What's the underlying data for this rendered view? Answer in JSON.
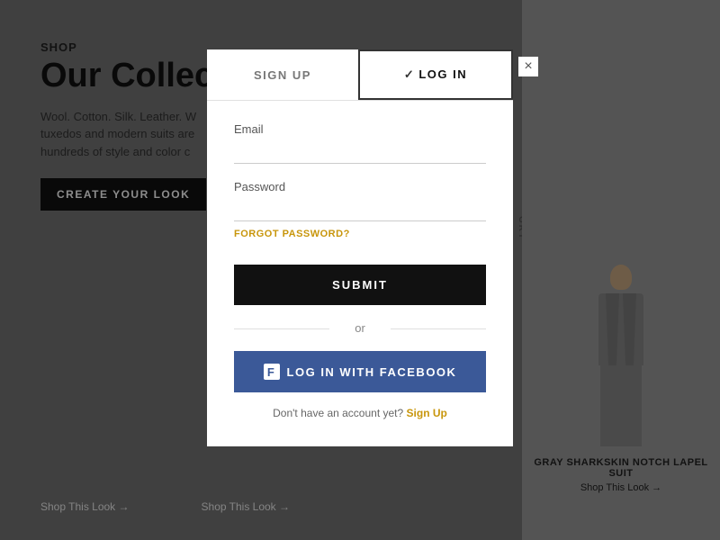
{
  "background": {
    "shop_label": "SHOP",
    "collection_title": "Our Collecti",
    "description": "Wool. Cotton. Silk. Leather. W tuxedos and modern suits are hundreds of style and color c",
    "cta_button_label": "CREATE YOUR LOOK",
    "gray_vertical_label": "GRY",
    "suit_name": "GRAY SHARKSKIN NOTCH LAPEL SUIT",
    "shop_look_links": [
      "Shop This Look →",
      "Shop This Look →",
      "Shop This Look →"
    ]
  },
  "modal": {
    "signup_tab_label": "SIGN UP",
    "login_tab_label": "LOG IN",
    "close_icon": "×",
    "email_label": "Email",
    "email_placeholder": "",
    "password_label": "Password",
    "password_placeholder": "",
    "forgot_password_label": "FORGOT PASSWORD?",
    "submit_label": "SUBMIT",
    "or_text": "or",
    "facebook_button_label": "LOG IN WITH FACEBOOK",
    "facebook_icon_label": "f",
    "signup_prompt": "Don't have an account yet?",
    "signup_link_label": "Sign Up"
  }
}
